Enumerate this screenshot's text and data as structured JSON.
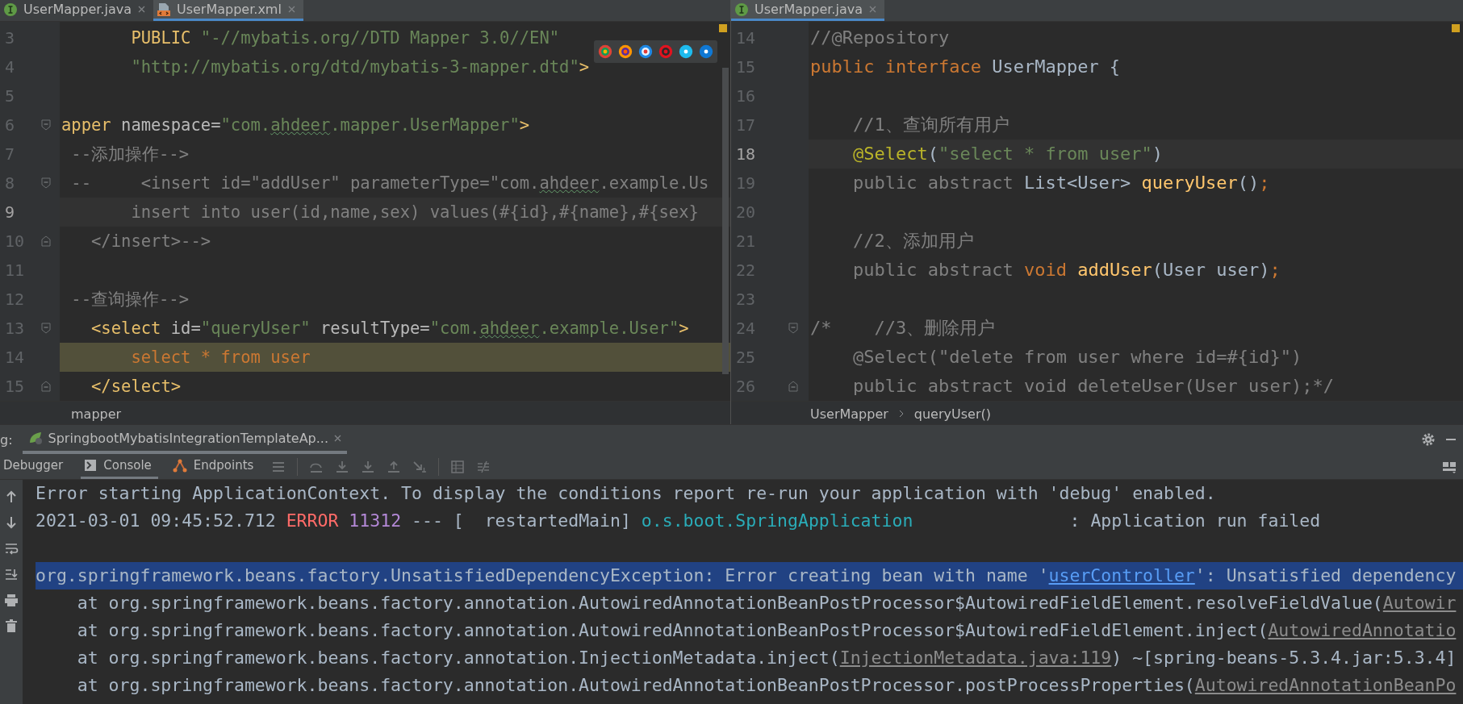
{
  "left_editor": {
    "tabs": [
      {
        "label": "UserMapper.java",
        "selected": false,
        "kind": "java"
      },
      {
        "label": "UserMapper.xml",
        "selected": true,
        "kind": "xml"
      }
    ],
    "lines": [
      {
        "number": "3",
        "current": false,
        "highlighted": false,
        "fold_open": false,
        "fold_close": false,
        "tokens": [
          {
            "text": "       PUBLIC ",
            "kind": "tag"
          },
          {
            "text": "\"-//mybatis.org//DTD Mapper 3.0//EN\"",
            "kind": "string"
          }
        ]
      },
      {
        "number": "4",
        "current": false,
        "highlighted": false,
        "fold_open": false,
        "fold_close": false,
        "tokens": [
          {
            "text": "       \"http://mybatis.org/dtd/mybatis-3-mapper.dtd\"",
            "kind": "string"
          },
          {
            "text": ">",
            "kind": "tag"
          }
        ]
      },
      {
        "number": "5",
        "current": false,
        "highlighted": false,
        "fold_open": false,
        "fold_close": false
      },
      {
        "number": "6",
        "current": false,
        "highlighted": false,
        "fold_open": true,
        "fold_close": false,
        "tokens": [
          {
            "text": "apper",
            "kind": "tag"
          },
          {
            "text": " namespace=",
            "kind": "attr"
          },
          {
            "text": "\"com.",
            "kind": "string"
          },
          {
            "text": "ahdeer",
            "kind": "string_typo"
          },
          {
            "text": ".mapper.UserMapper\"",
            "kind": "string"
          },
          {
            "text": ">",
            "kind": "tag"
          }
        ]
      },
      {
        "number": "7",
        "current": false,
        "highlighted": false,
        "fold_open": false,
        "fold_close": false,
        "tokens": [
          {
            "text": " --添加操作-->",
            "kind": "comment"
          }
        ]
      },
      {
        "number": "8",
        "current": false,
        "highlighted": false,
        "fold_open": true,
        "fold_close": false,
        "tokens": [
          {
            "text": " --     <insert id=\"addUser\" parameterType=\"com.",
            "kind": "comment"
          },
          {
            "text": "ahdeer",
            "kind": "comment_typo"
          },
          {
            "text": ".example.Us",
            "kind": "comment"
          }
        ]
      },
      {
        "number": "9",
        "current": true,
        "highlighted": false,
        "fold_open": false,
        "fold_close": false,
        "tokens": [
          {
            "text": "       insert into user(id,name,sex) values(#{id},#{name},#{sex}",
            "kind": "comment"
          }
        ]
      },
      {
        "number": "10",
        "current": false,
        "highlighted": false,
        "fold_open": false,
        "fold_close": true,
        "tokens": [
          {
            "text": "   </insert>-->",
            "kind": "comment"
          }
        ]
      },
      {
        "number": "11",
        "current": false,
        "highlighted": false,
        "fold_open": false,
        "fold_close": false
      },
      {
        "number": "12",
        "current": false,
        "highlighted": false,
        "fold_open": false,
        "fold_close": false,
        "tokens": [
          {
            "text": " --查询操作-->",
            "kind": "comment"
          }
        ]
      },
      {
        "number": "13",
        "current": false,
        "highlighted": false,
        "fold_open": true,
        "fold_close": false,
        "tokens": [
          {
            "text": "   <select",
            "kind": "tag"
          },
          {
            "text": " id=",
            "kind": "attr"
          },
          {
            "text": "\"queryUser\"",
            "kind": "string"
          },
          {
            "text": " resultType=",
            "kind": "attr"
          },
          {
            "text": "\"com.",
            "kind": "string"
          },
          {
            "text": "ahdeer",
            "kind": "string_typo"
          },
          {
            "text": ".example.User\"",
            "kind": "string"
          },
          {
            "text": ">",
            "kind": "tag"
          }
        ]
      },
      {
        "number": "14",
        "current": false,
        "highlighted": true,
        "fold_open": false,
        "fold_close": false,
        "tokens": [
          {
            "text": "       select * from user",
            "kind": "keyword"
          }
        ]
      },
      {
        "number": "15",
        "current": false,
        "highlighted": false,
        "fold_open": false,
        "fold_close": true,
        "tokens": [
          {
            "text": "   </select>",
            "kind": "tag"
          }
        ]
      }
    ],
    "breadcrumb": [
      "mapper"
    ]
  },
  "right_editor": {
    "tabs": [
      {
        "label": "UserMapper.java",
        "selected": true,
        "kind": "java"
      }
    ],
    "lines": [
      {
        "number": "14",
        "current": false,
        "highlighted": false,
        "fold_open": false,
        "fold_close": false,
        "tokens": [
          {
            "text": "//@Repository",
            "kind": "comment"
          }
        ]
      },
      {
        "number": "15",
        "current": false,
        "highlighted": false,
        "fold_open": false,
        "fold_close": false,
        "tokens": [
          {
            "text": "public interface ",
            "kind": "keyword"
          },
          {
            "text": "UserMapper {",
            "kind": "plain"
          }
        ]
      },
      {
        "number": "16",
        "current": false,
        "highlighted": false,
        "fold_open": false,
        "fold_close": false
      },
      {
        "number": "17",
        "current": false,
        "highlighted": false,
        "fold_open": false,
        "fold_close": false,
        "tokens": [
          {
            "text": "    //1、查询所有用户",
            "kind": "comment"
          }
        ]
      },
      {
        "number": "18",
        "current": true,
        "highlighted": false,
        "fold_open": false,
        "fold_close": false,
        "tokens": [
          {
            "text": "    @Select",
            "kind": "annotation"
          },
          {
            "text": "(",
            "kind": "plain"
          },
          {
            "text": "\"select * from user\"",
            "kind": "string"
          },
          {
            "text": ")",
            "kind": "plain"
          }
        ]
      },
      {
        "number": "19",
        "current": false,
        "highlighted": false,
        "fold_open": false,
        "fold_close": false,
        "tokens": [
          {
            "text": "    public abstract ",
            "kind": "modifier"
          },
          {
            "text": "List<User> ",
            "kind": "plain"
          },
          {
            "text": "queryUser",
            "kind": "method"
          },
          {
            "text": "()",
            "kind": "plain"
          },
          {
            "text": ";",
            "kind": "keyword"
          }
        ]
      },
      {
        "number": "20",
        "current": false,
        "highlighted": false,
        "fold_open": false,
        "fold_close": false
      },
      {
        "number": "21",
        "current": false,
        "highlighted": false,
        "fold_open": false,
        "fold_close": false,
        "tokens": [
          {
            "text": "    //2、添加用户",
            "kind": "comment"
          }
        ]
      },
      {
        "number": "22",
        "current": false,
        "highlighted": false,
        "fold_open": false,
        "fold_close": false,
        "tokens": [
          {
            "text": "    public abstract ",
            "kind": "modifier"
          },
          {
            "text": "void ",
            "kind": "keyword"
          },
          {
            "text": "addUser",
            "kind": "method"
          },
          {
            "text": "(User user)",
            "kind": "plain"
          },
          {
            "text": ";",
            "kind": "keyword"
          }
        ]
      },
      {
        "number": "23",
        "current": false,
        "highlighted": false,
        "fold_open": false,
        "fold_close": false
      },
      {
        "number": "24",
        "current": false,
        "highlighted": false,
        "fold_open": true,
        "fold_close": false,
        "tokens": [
          {
            "text": "/*    //3、删除用户",
            "kind": "comment"
          }
        ]
      },
      {
        "number": "25",
        "current": false,
        "highlighted": false,
        "fold_open": false,
        "fold_close": false,
        "tokens": [
          {
            "text": "    @Select(\"delete from user where id=#{id}\")",
            "kind": "comment"
          }
        ]
      },
      {
        "number": "26",
        "current": false,
        "highlighted": false,
        "fold_open": false,
        "fold_close": true,
        "tokens": [
          {
            "text": "    public abstract void deleteUser(User user);*/",
            "kind": "comment"
          }
        ]
      }
    ],
    "breadcrumb": [
      "UserMapper",
      "queryUser()"
    ]
  },
  "run_panel": {
    "label": "g:",
    "tabs": [
      {
        "label": "SpringbootMybatisIntegrationTemplateAp...",
        "selected": true
      }
    ],
    "tool_tabs": [
      {
        "label": "Debugger",
        "selected": false,
        "kind": "debugger"
      },
      {
        "label": "Console",
        "selected": true,
        "kind": "console"
      },
      {
        "label": "Endpoints",
        "selected": false,
        "kind": "endpoints"
      }
    ],
    "console": [
      {
        "selected": false,
        "tokens": [
          {
            "text": "Error starting ApplicationContext. To display the conditions report re-run your application with 'debug' enabled.",
            "kind": "plain"
          }
        ]
      },
      {
        "selected": false,
        "tokens": [
          {
            "text": "2021-03-01 09:45:52.712 ",
            "kind": "plain"
          },
          {
            "text": "ERROR",
            "kind": "error"
          },
          {
            "text": " 11312",
            "kind": "pid"
          },
          {
            "text": " --- [  restartedMain] ",
            "kind": "plain"
          },
          {
            "text": "o.s.boot.SpringApplication",
            "kind": "logger"
          },
          {
            "text": "               : Application run failed",
            "kind": "plain"
          }
        ]
      },
      {
        "selected": false
      },
      {
        "selected": true,
        "tokens": [
          {
            "text": "org.springframework.beans.factory.UnsatisfiedDependencyException: Error creating bean with name '",
            "kind": "plain"
          },
          {
            "text": "userController",
            "kind": "link"
          },
          {
            "text": "': Unsatisfied dependency",
            "kind": "plain"
          }
        ]
      },
      {
        "selected": false,
        "tokens": [
          {
            "text": "    at org.springframework.beans.factory.annotation.AutowiredAnnotationBeanPostProcessor$AutowiredFieldElement.resolveFieldValue(",
            "kind": "plain"
          },
          {
            "text": "Autowir",
            "kind": "source_link"
          }
        ]
      },
      {
        "selected": false,
        "tokens": [
          {
            "text": "    at org.springframework.beans.factory.annotation.AutowiredAnnotationBeanPostProcessor$AutowiredFieldElement.inject(",
            "kind": "plain"
          },
          {
            "text": "AutowiredAnnotatio",
            "kind": "source_link"
          }
        ]
      },
      {
        "selected": false,
        "tokens": [
          {
            "text": "    at org.springframework.beans.factory.annotation.InjectionMetadata.inject(",
            "kind": "plain"
          },
          {
            "text": "InjectionMetadata.java:119",
            "kind": "source_link"
          },
          {
            "text": ") ~[spring-beans-5.3.4.jar:5.3.4]",
            "kind": "plain"
          }
        ]
      },
      {
        "selected": false,
        "tokens": [
          {
            "text": "    at org.springframework.beans.factory.annotation.AutowiredAnnotationBeanPostProcessor.postProcessProperties(",
            "kind": "plain"
          },
          {
            "text": "AutowiredAnnotationBeanPo",
            "kind": "source_link"
          }
        ]
      }
    ]
  }
}
